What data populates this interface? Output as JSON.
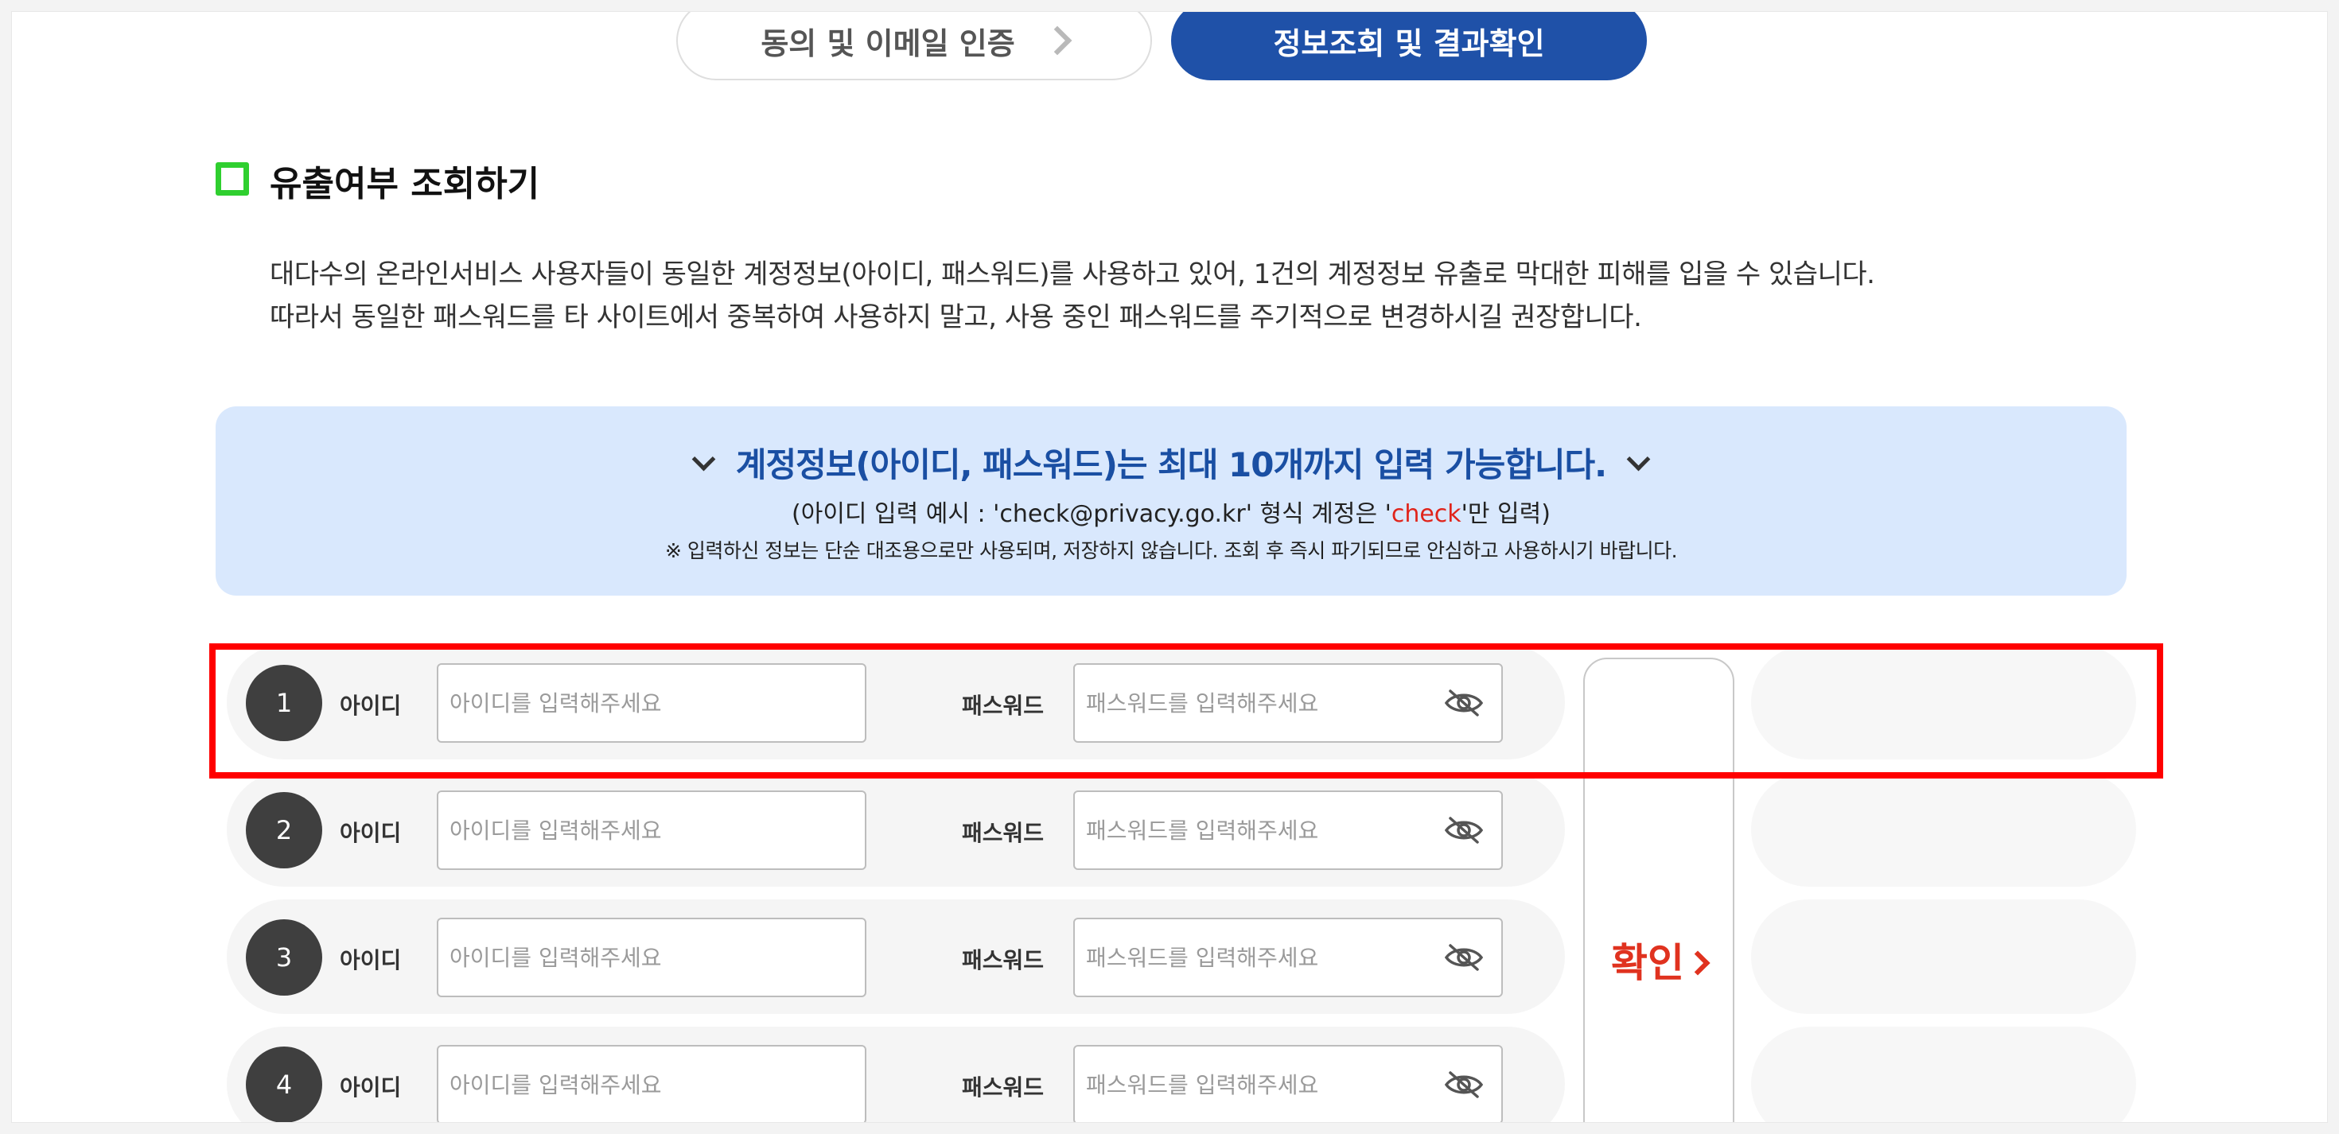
{
  "steps": [
    {
      "label": "동의 및 이메일 인증",
      "active": false
    },
    {
      "label": "정보조회 및 결과확인",
      "active": true
    }
  ],
  "section": {
    "title": "유출여부 조회하기",
    "desc_line1": "대다수의 온라인서비스 사용자들이 동일한 계정정보(아이디, 패스워드)를 사용하고 있어, 1건의 계정정보 유출로 막대한 피해를 입을 수 있습니다.",
    "desc_line2": "따라서 동일한 패스워드를 타 사이트에서 중복하여 사용하지 말고, 사용 중인 패스워드를 주기적으로 변경하시길 권장합니다."
  },
  "banner": {
    "headline": "계정정보(아이디, 패스워드)는 최대 10개까지 입력 가능합니다.",
    "example_prefix": "(아이디 입력 예시 : 'check@privacy.go.kr' 형식 계정은 '",
    "example_highlight": "check",
    "example_suffix": "'만 입력)",
    "note": "※ 입력하신 정보는 단순 대조용으로만 사용되며, 저장하지 않습니다. 조회 후 즉시 파기되므로 안심하고 사용하시기 바랍니다."
  },
  "form": {
    "id_label": "아이디",
    "pw_label": "패스워드",
    "id_placeholder": "아이디를 입력해주세요",
    "pw_placeholder": "패스워드를 입력해주세요",
    "rows": [
      {
        "num": "1",
        "id_value": "",
        "pw_value": ""
      },
      {
        "num": "2",
        "id_value": "",
        "pw_value": ""
      },
      {
        "num": "3",
        "id_value": "",
        "pw_value": ""
      },
      {
        "num": "4",
        "id_value": "",
        "pw_value": ""
      }
    ],
    "confirm_label": "확인"
  },
  "colors": {
    "primary_blue": "#1f51a8",
    "banner_bg": "#d9e8fd",
    "accent_red": "#e0321f",
    "check_green": "#2fcf2f",
    "highlight_red": "#ff0000"
  },
  "icons": {
    "password_toggle": "eye-slash-icon",
    "step_arrow": "chevron-right-icon",
    "banner_arrow": "chevron-down-icon"
  }
}
